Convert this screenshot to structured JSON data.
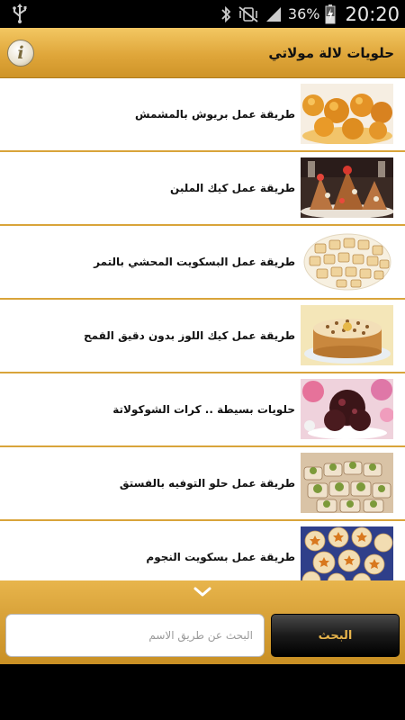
{
  "status_bar": {
    "battery": "36%",
    "time": "20:20"
  },
  "header": {
    "title": "حلويات لالة مولاتي",
    "info_icon": "i"
  },
  "items": [
    {
      "label": "طريقة عمل بريوش بالمشمش",
      "image": "apricot-brioche-thumbnail"
    },
    {
      "label": "طريقة عمل كيك الملبن",
      "image": "malban-cake-thumbnail"
    },
    {
      "label": "طريقة عمل البسكويت المحشي بالتمر",
      "image": "date-filled-biscuits-thumbnail"
    },
    {
      "label": "طريقة عمل كيك اللوز بدون دقيق القمح",
      "image": "almond-cake-thumbnail"
    },
    {
      "label": "حلويات بسيطة .. كرات الشوكولاتة",
      "image": "chocolate-balls-thumbnail"
    },
    {
      "label": "طريقة عمل حلو التوفيه بالفستق",
      "image": "pistachio-toffee-thumbnail"
    },
    {
      "label": "طريقة عمل بسكويت النجوم",
      "image": "star-biscuits-thumbnail"
    }
  ],
  "search": {
    "placeholder": "البحث عن طريق الاسم",
    "button_label": "البحث"
  },
  "colors": {
    "header_gold": "#dfa63a",
    "row_divider": "#d9a43a",
    "button_text": "#e8b54c"
  }
}
